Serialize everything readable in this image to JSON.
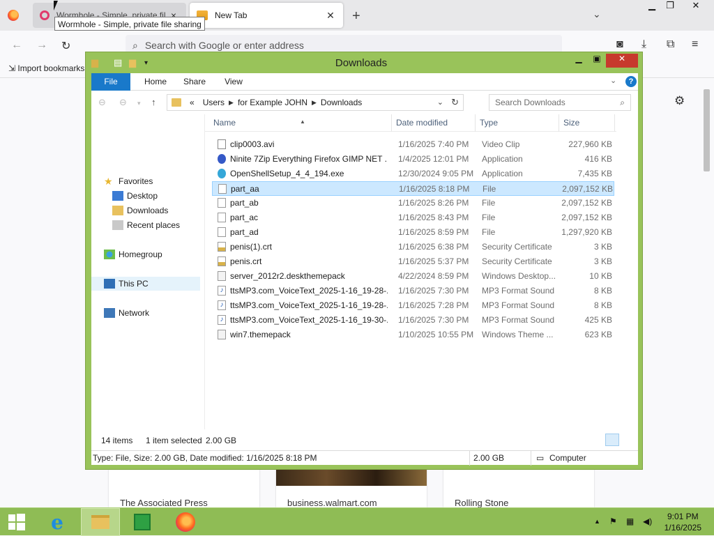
{
  "browser": {
    "tabs": [
      {
        "title": "Wormhole - Simple, private fil",
        "active": false
      },
      {
        "title": "New Tab",
        "active": true
      }
    ],
    "tooltip": "Wormhole - Simple, private file sharing",
    "new_tab": "+",
    "urlbar_placeholder": "Search with Google or enter address",
    "import_bookmarks": "Import bookmarks...",
    "page_cards": [
      "The Associated Press",
      "business.walmart.com",
      "Rolling Stone"
    ]
  },
  "explorer": {
    "title": "Downloads",
    "ribbon_tabs": [
      "File",
      "Home",
      "Share",
      "View"
    ],
    "breadcrumb": [
      "«",
      "Users",
      "for Example JOHN",
      "Downloads"
    ],
    "search_placeholder": "Search Downloads",
    "nav": {
      "favorites": "Favorites",
      "desktop": "Desktop",
      "downloads": "Downloads",
      "recent": "Recent places",
      "homegroup": "Homegroup",
      "thispc": "This PC",
      "network": "Network"
    },
    "columns": [
      "Name",
      "Date modified",
      "Type",
      "Size"
    ],
    "files": [
      {
        "name": "clip0003.avi",
        "date": "1/16/2025 7:40 PM",
        "type": "Video Clip",
        "size": "227,960 KB",
        "icon": "video-file-icon"
      },
      {
        "name": "Ninite 7Zip Everything Firefox GIMP NET ...",
        "date": "1/4/2025 12:01 PM",
        "type": "Application",
        "size": "416 KB",
        "icon": "ninite-app-icon"
      },
      {
        "name": "OpenShellSetup_4_4_194.exe",
        "date": "12/30/2024 9:05 PM",
        "type": "Application",
        "size": "7,435 KB",
        "icon": "openshell-app-icon"
      },
      {
        "name": "part_aa",
        "date": "1/16/2025 8:18 PM",
        "type": "File",
        "size": "2,097,152 KB",
        "icon": "blank-file-icon",
        "selected": true
      },
      {
        "name": "part_ab",
        "date": "1/16/2025 8:26 PM",
        "type": "File",
        "size": "2,097,152 KB",
        "icon": "blank-file-icon"
      },
      {
        "name": "part_ac",
        "date": "1/16/2025 8:43 PM",
        "type": "File",
        "size": "2,097,152 KB",
        "icon": "blank-file-icon"
      },
      {
        "name": "part_ad",
        "date": "1/16/2025 8:59 PM",
        "type": "File",
        "size": "1,297,920 KB",
        "icon": "blank-file-icon"
      },
      {
        "name": "penis(1).crt",
        "date": "1/16/2025 6:38 PM",
        "type": "Security Certificate",
        "size": "3 KB",
        "icon": "certificate-icon"
      },
      {
        "name": "penis.crt",
        "date": "1/16/2025 5:37 PM",
        "type": "Security Certificate",
        "size": "3 KB",
        "icon": "certificate-icon"
      },
      {
        "name": "server_2012r2.deskthemepack",
        "date": "4/22/2024 8:59 PM",
        "type": "Windows Desktop...",
        "size": "10 KB",
        "icon": "themepack-icon"
      },
      {
        "name": "ttsMP3.com_VoiceText_2025-1-16_19-28-...",
        "date": "1/16/2025 7:30 PM",
        "type": "MP3 Format Sound",
        "size": "8 KB",
        "icon": "audio-file-icon"
      },
      {
        "name": "ttsMP3.com_VoiceText_2025-1-16_19-28-...",
        "date": "1/16/2025 7:28 PM",
        "type": "MP3 Format Sound",
        "size": "8 KB",
        "icon": "audio-file-icon"
      },
      {
        "name": "ttsMP3.com_VoiceText_2025-1-16_19-30-...",
        "date": "1/16/2025 7:30 PM",
        "type": "MP3 Format Sound",
        "size": "425 KB",
        "icon": "audio-file-icon"
      },
      {
        "name": "win7.themepack",
        "date": "1/10/2025 10:55 PM",
        "type": "Windows Theme ...",
        "size": "623 KB",
        "icon": "themepack-icon"
      }
    ],
    "status": {
      "items": "14 items",
      "selected": "1 item selected",
      "selected_size": "2.00 GB"
    },
    "details": {
      "summary": "Type: File, Size: 2.00 GB, Date modified: 1/16/2025 8:18 PM",
      "size": "2.00 GB",
      "location": "Computer"
    }
  },
  "taskbar": {
    "time": "9:01 PM",
    "date": "1/16/2025"
  },
  "colors": {
    "window_frame": "#99c35a",
    "taskbar": "#8fbc55",
    "accent_blue": "#1979ca",
    "selection": "#cce8ff"
  }
}
